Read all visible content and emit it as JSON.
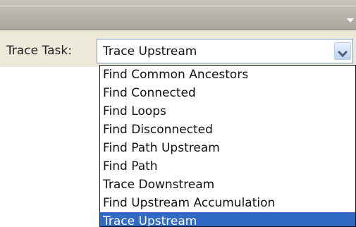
{
  "form": {
    "trace_task_label": "Trace Task:"
  },
  "select": {
    "selected": "Trace Upstream",
    "arrow_icon": "chevron-down-icon"
  },
  "dropdown": {
    "items": [
      "Find Common Ancestors",
      "Find Connected",
      "Find Loops",
      "Find Disconnected",
      "Find Path Upstream",
      "Find Path",
      "Trace Downstream",
      "Find Upstream Accumulation",
      "Trace Upstream"
    ]
  },
  "colors": {
    "selected_bg": "#316ac5",
    "dropdown_border": "#111111",
    "panel_bg": "#ece9d8",
    "select_border": "#7f9db9"
  }
}
